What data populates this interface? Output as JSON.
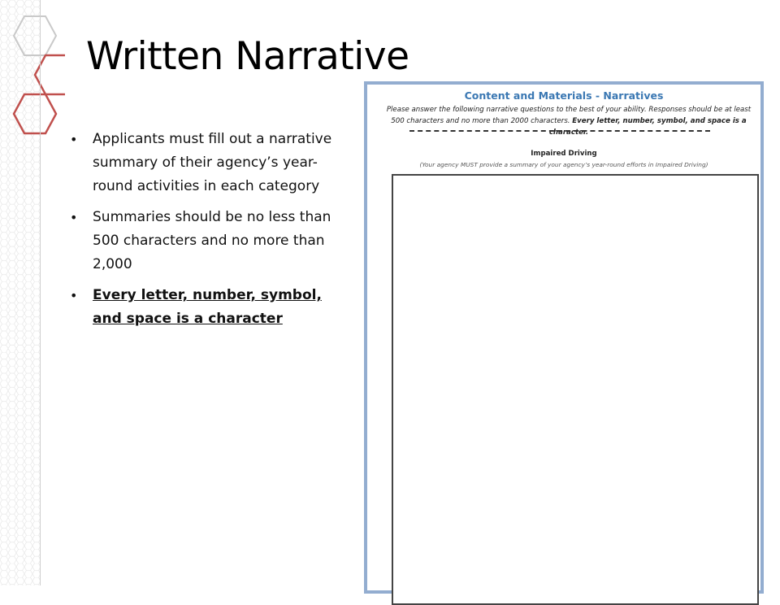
{
  "slide": {
    "title": "Written Narrative",
    "bullets": [
      "Applicants must fill out a narrative summary of their agency’s year-round activities in each category",
      "Summaries should be no less than 500 characters and no more than 2,000",
      "Every letter, number, symbol, and space is a character"
    ]
  },
  "document": {
    "title": "Content and Materials - Narratives",
    "instructions_plain": "Please answer the following narrative questions to the best of your ability. Responses should be at least 500 characters and no more than 2000 characters.",
    "instructions_bold": "Every letter, number, symbol, and space is a character.",
    "section_heading": "Impaired Driving",
    "section_note": "(Your agency MUST provide a summary of your agency’s year-round efforts in Impaired Driving)"
  },
  "colors": {
    "accent_red": "#c0504d",
    "frame_blue": "#93add0",
    "doc_title_blue": "#3b78b3"
  }
}
